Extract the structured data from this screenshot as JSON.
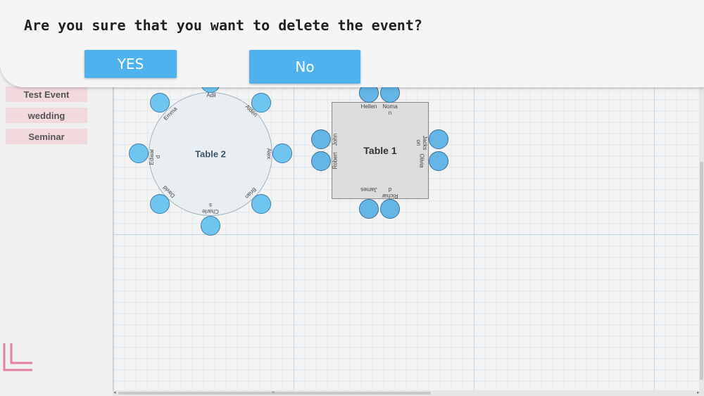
{
  "dialog": {
    "question": "Are you sure that you want to delete the event?",
    "yes_label": "YES",
    "no_label": "No"
  },
  "sidebar": {
    "events": [
      {
        "label": "Test Event"
      },
      {
        "label": "wedding"
      },
      {
        "label": "Seminar"
      }
    ],
    "corner_icon": "corner-bracket-icon"
  },
  "tables": {
    "round": {
      "label": "Table 2",
      "guests": [
        "Adil",
        "Alden",
        "Alex",
        "Brian",
        "Charles",
        "David",
        "Edward",
        "Emma"
      ]
    },
    "square": {
      "label": "Table 1",
      "top": [
        "Hellen",
        "Noman"
      ],
      "right": [
        "Jackson",
        "Olivia"
      ],
      "bottom": [
        "Richard",
        "James"
      ],
      "left": [
        "John",
        "Robert"
      ]
    }
  },
  "colors": {
    "accent": "#4fb2ef",
    "seat": "#6ec6f0",
    "event_item": "#f2d9de",
    "corner_icon": "#e47f9c"
  }
}
